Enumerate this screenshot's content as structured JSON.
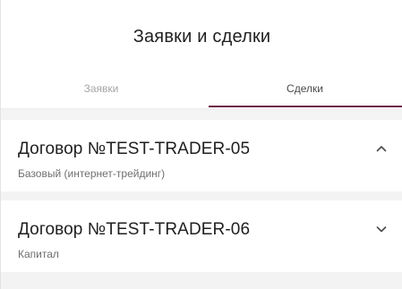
{
  "header": {
    "title": "Заявки и сделки"
  },
  "tabs": [
    {
      "label": "Заявки",
      "active": false
    },
    {
      "label": "Сделки",
      "active": true
    }
  ],
  "contracts": [
    {
      "title": "Договор №TEST-TRADER-05",
      "subtitle": "Базовый (интернет-трейдинг)",
      "expanded": true,
      "chevron": "chevron-up-icon"
    },
    {
      "title": "Договор №TEST-TRADER-06",
      "subtitle": "Капитал",
      "expanded": false,
      "chevron": "chevron-down-icon"
    }
  ],
  "colors": {
    "accent": "#6e1f48",
    "section_gap": "#f3f3f4",
    "text_primary": "#1f1f1f",
    "text_secondary": "#6f6f6f",
    "tab_inactive": "#a6a6a6"
  }
}
